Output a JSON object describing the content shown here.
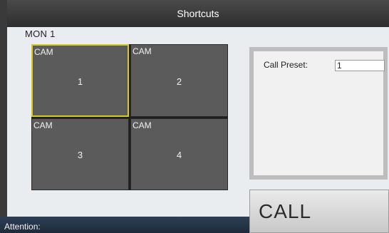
{
  "window": {
    "title": "Shortcuts"
  },
  "monitor": {
    "label": "MON 1"
  },
  "cameras": [
    {
      "label": "CAM",
      "number": "1",
      "selected": true
    },
    {
      "label": "CAM",
      "number": "2",
      "selected": false
    },
    {
      "label": "CAM",
      "number": "3",
      "selected": false
    },
    {
      "label": "CAM",
      "number": "4",
      "selected": false
    }
  ],
  "preset": {
    "label": "Call Preset:",
    "value": "1"
  },
  "call_button": {
    "label": "CALL"
  },
  "status": {
    "attention_label": "Attention:"
  },
  "colors": {
    "selection_border": "#d8c828",
    "title_bar": "#3a3a3a",
    "status_bar": "#1d2a3a"
  }
}
